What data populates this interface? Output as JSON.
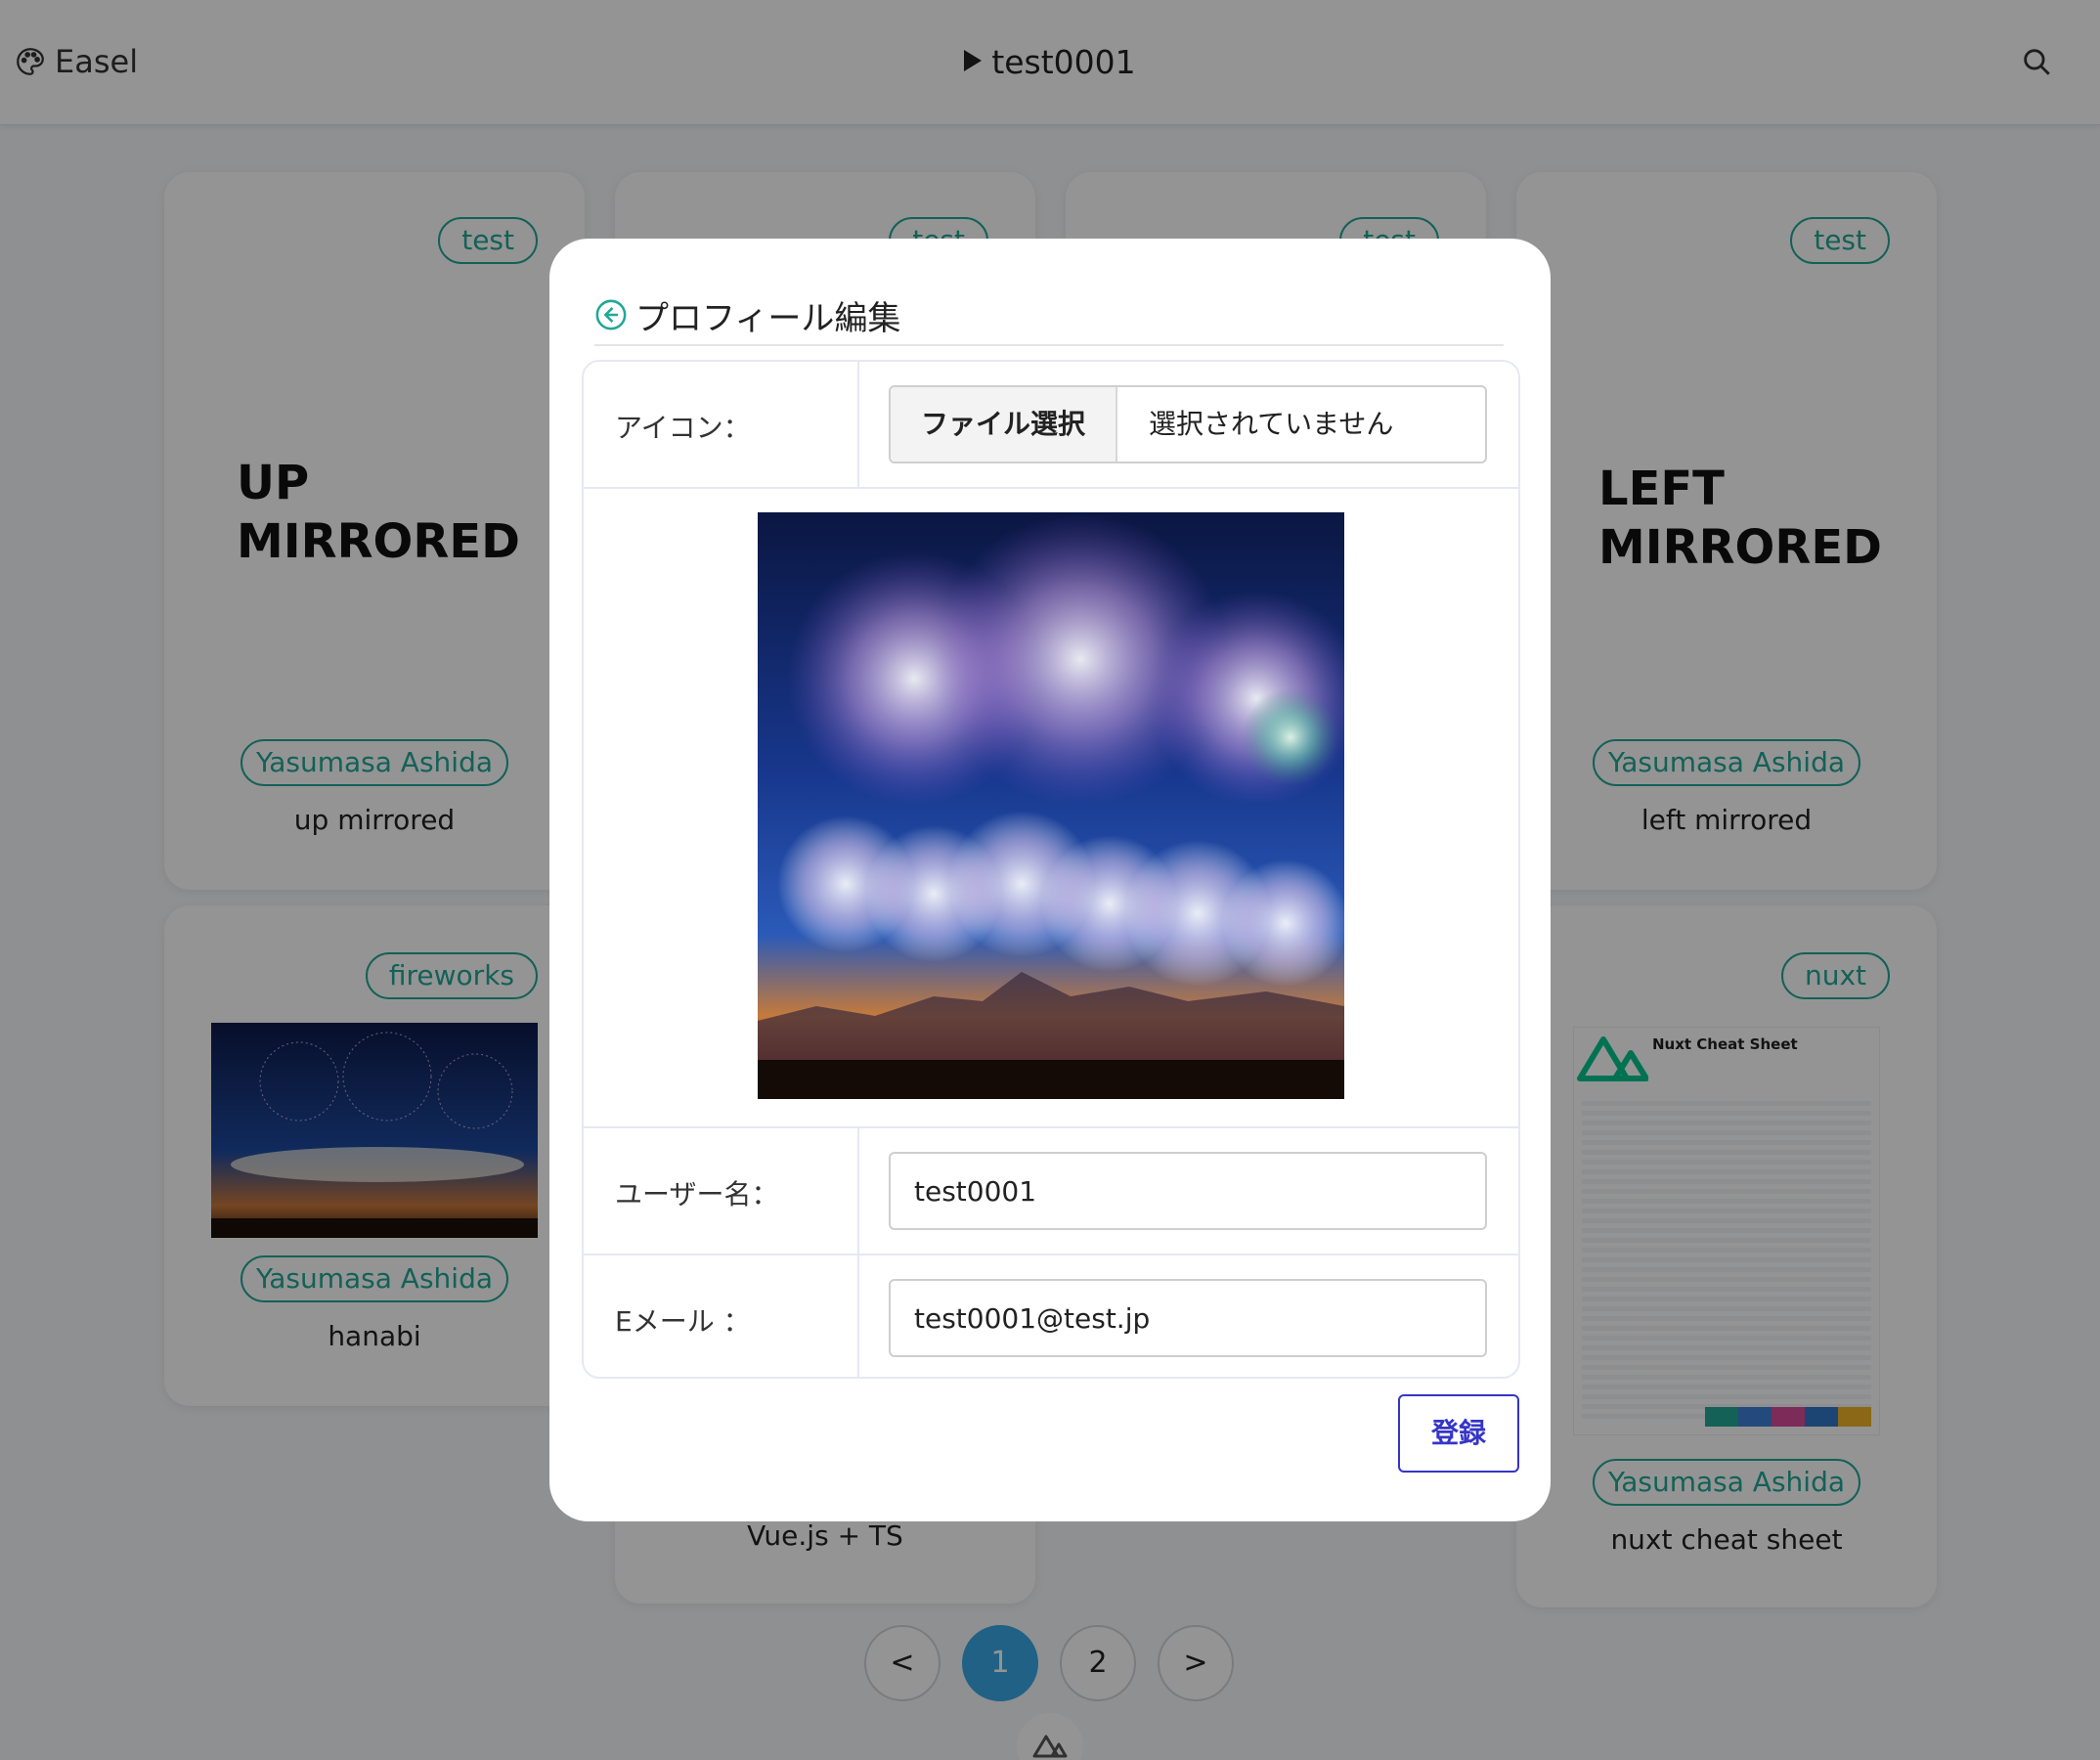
{
  "header": {
    "brand": "Easel",
    "title": "test0001"
  },
  "cards": {
    "c1": {
      "tag": "test",
      "bigtext_line1": "UP",
      "bigtext_line2": "MIRRORED",
      "author": "Yasumasa Ashida",
      "title": "up mirrored"
    },
    "c2": {
      "tag": "test"
    },
    "c3": {
      "tag": "test"
    },
    "c4": {
      "tag": "test",
      "bigtext_line1": "LEFT",
      "bigtext_line2": "MIRRORED",
      "author": "Yasumasa Ashida",
      "title": "left mirrored"
    },
    "c5": {
      "tag": "fireworks",
      "author": "Yasumasa Ashida",
      "title": "hanabi"
    },
    "c6": {
      "title": "Vue.js + TS"
    },
    "c8": {
      "tag": "nuxt",
      "author": "Yasumasa Ashida",
      "title": "nuxt cheat sheet",
      "image_heading": "Nuxt Cheat Sheet"
    }
  },
  "pagination": {
    "prev": "<",
    "pages": [
      "1",
      "2"
    ],
    "next": ">",
    "current": "1"
  },
  "modal": {
    "title": "プロフィール編集",
    "icon_label": "アイコン：",
    "file_button": "ファイル選択",
    "file_status": "選択されていません",
    "username_label": "ユーザー名：",
    "username_value": "test0001",
    "email_label": "Eメール ：",
    "email_value": "test0001@test.jp",
    "submit": "登録"
  }
}
